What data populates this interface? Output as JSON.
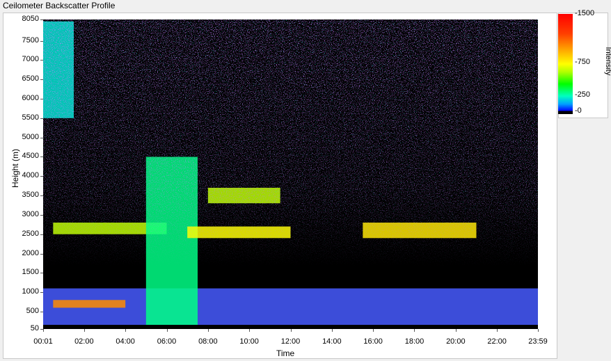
{
  "title": "Ceilometer Backscatter Profile",
  "chart_data": {
    "type": "heatmap",
    "title": "Ceilometer Backscatter Profile",
    "xlabel": "Time",
    "ylabel": "Height (m)",
    "x_ticks": [
      "00:01",
      "02:00",
      "04:00",
      "06:00",
      "08:00",
      "10:00",
      "12:00",
      "14:00",
      "16:00",
      "18:00",
      "20:00",
      "22:00",
      "23:59"
    ],
    "y_ticks": [
      "8050",
      "7500",
      "7000",
      "6500",
      "6000",
      "5500",
      "5000",
      "4500",
      "4000",
      "3500",
      "3000",
      "2500",
      "2000",
      "1500",
      "1000",
      "500",
      "50"
    ],
    "xlim": [
      "00:01",
      "23:59"
    ],
    "ylim": [
      50,
      8050
    ],
    "colorbar": {
      "label": "Intensity",
      "ticks": [
        "1500",
        "750",
        "250",
        "0"
      ],
      "range": [
        0,
        1500
      ],
      "colors": [
        "#000000",
        "#0000ff",
        "#00ffff",
        "#00ff00",
        "#ffff00",
        "#ff8000",
        "#ff0000"
      ]
    },
    "layers": [
      {
        "from": "00:01",
        "to": "23:59",
        "base_m": 50,
        "top_m": 1100,
        "intensity": 150
      },
      {
        "from": "00:30",
        "to": "06:00",
        "base_m": 2500,
        "top_m": 2800,
        "intensity": 600
      },
      {
        "from": "05:00",
        "to": "07:30",
        "base_m": 50,
        "top_m": 4500,
        "intensity": 350
      },
      {
        "from": "07:00",
        "to": "12:00",
        "base_m": 2400,
        "top_m": 2700,
        "intensity": 650
      },
      {
        "from": "08:00",
        "to": "11:30",
        "base_m": 3300,
        "top_m": 3700,
        "intensity": 600
      },
      {
        "from": "15:30",
        "to": "21:00",
        "base_m": 2400,
        "top_m": 2800,
        "intensity": 700
      },
      {
        "from": "00:30",
        "to": "04:00",
        "base_m": 600,
        "top_m": 800,
        "intensity": 900
      },
      {
        "from": "00:01",
        "to": "01:30",
        "base_m": 5500,
        "top_m": 8000,
        "intensity": 280
      }
    ]
  }
}
